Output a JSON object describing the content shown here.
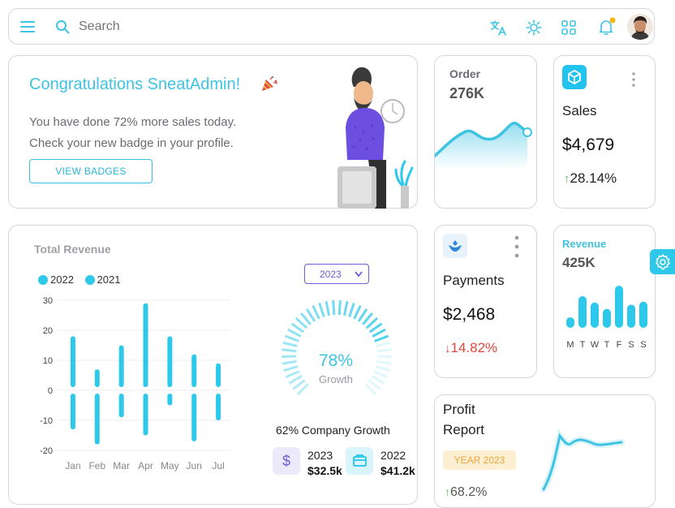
{
  "colors": {
    "accent": "#3fc3e3",
    "positive": "#3cb371",
    "negative": "#e0483e",
    "badge_bg": "#fdf0d2",
    "badge_text": "#f0a23a"
  },
  "topbar": {
    "search_placeholder": "Search",
    "icons": [
      "menu-icon",
      "search-icon",
      "translate-icon",
      "sun-icon",
      "grid-icon",
      "bell-icon"
    ]
  },
  "congrats": {
    "title": "Congratulations SneatAdmin!",
    "line1": "You have done 72% more sales today.",
    "line2": "Check your new badge in your profile.",
    "button": "VIEW BADGES"
  },
  "order": {
    "label": "Order",
    "value": "276K"
  },
  "sales": {
    "label": "Sales",
    "value": "$4,679",
    "change": "28.14%",
    "icon": "cube-icon"
  },
  "revenue_total": {
    "title": "Total Revenue",
    "year_select": "2023",
    "growth_pct": "78%",
    "growth_label": "Growth",
    "growth_fraction": 0.78,
    "company_growth": "62% Company Growth",
    "stats": [
      {
        "year": "2023",
        "value": "$32.5k",
        "icon": "dollar-icon"
      },
      {
        "year": "2022",
        "value": "$41.2k",
        "icon": "wallet-icon"
      }
    ]
  },
  "chart_data": {
    "type": "bar",
    "title": "Total Revenue",
    "categories": [
      "Jan",
      "Feb",
      "Mar",
      "Apr",
      "May",
      "Jun",
      "Jul"
    ],
    "series": [
      {
        "name": "2022",
        "values": [
          18,
          7,
          15,
          29,
          18,
          12,
          9
        ]
      },
      {
        "name": "2021",
        "values": [
          -13,
          -18,
          -9,
          -15,
          -5,
          -17,
          -10
        ]
      }
    ],
    "yticks": [
      30,
      20,
      10,
      0,
      -10,
      -20
    ],
    "ylim": [
      -20,
      30
    ],
    "legend": "top-left",
    "grid": true
  },
  "payments": {
    "label": "Payments",
    "value": "$2,468",
    "change": "14.82%"
  },
  "revenue_mini": {
    "label": "Revenue",
    "value": "425K",
    "days": [
      "M",
      "T",
      "W",
      "T",
      "F",
      "S",
      "S"
    ],
    "bars": [
      0.25,
      0.75,
      0.6,
      0.45,
      1.0,
      0.55,
      0.62
    ]
  },
  "profit": {
    "line1": "Profit",
    "line2": "Report",
    "badge": "YEAR 2023",
    "change": "68.2%"
  }
}
